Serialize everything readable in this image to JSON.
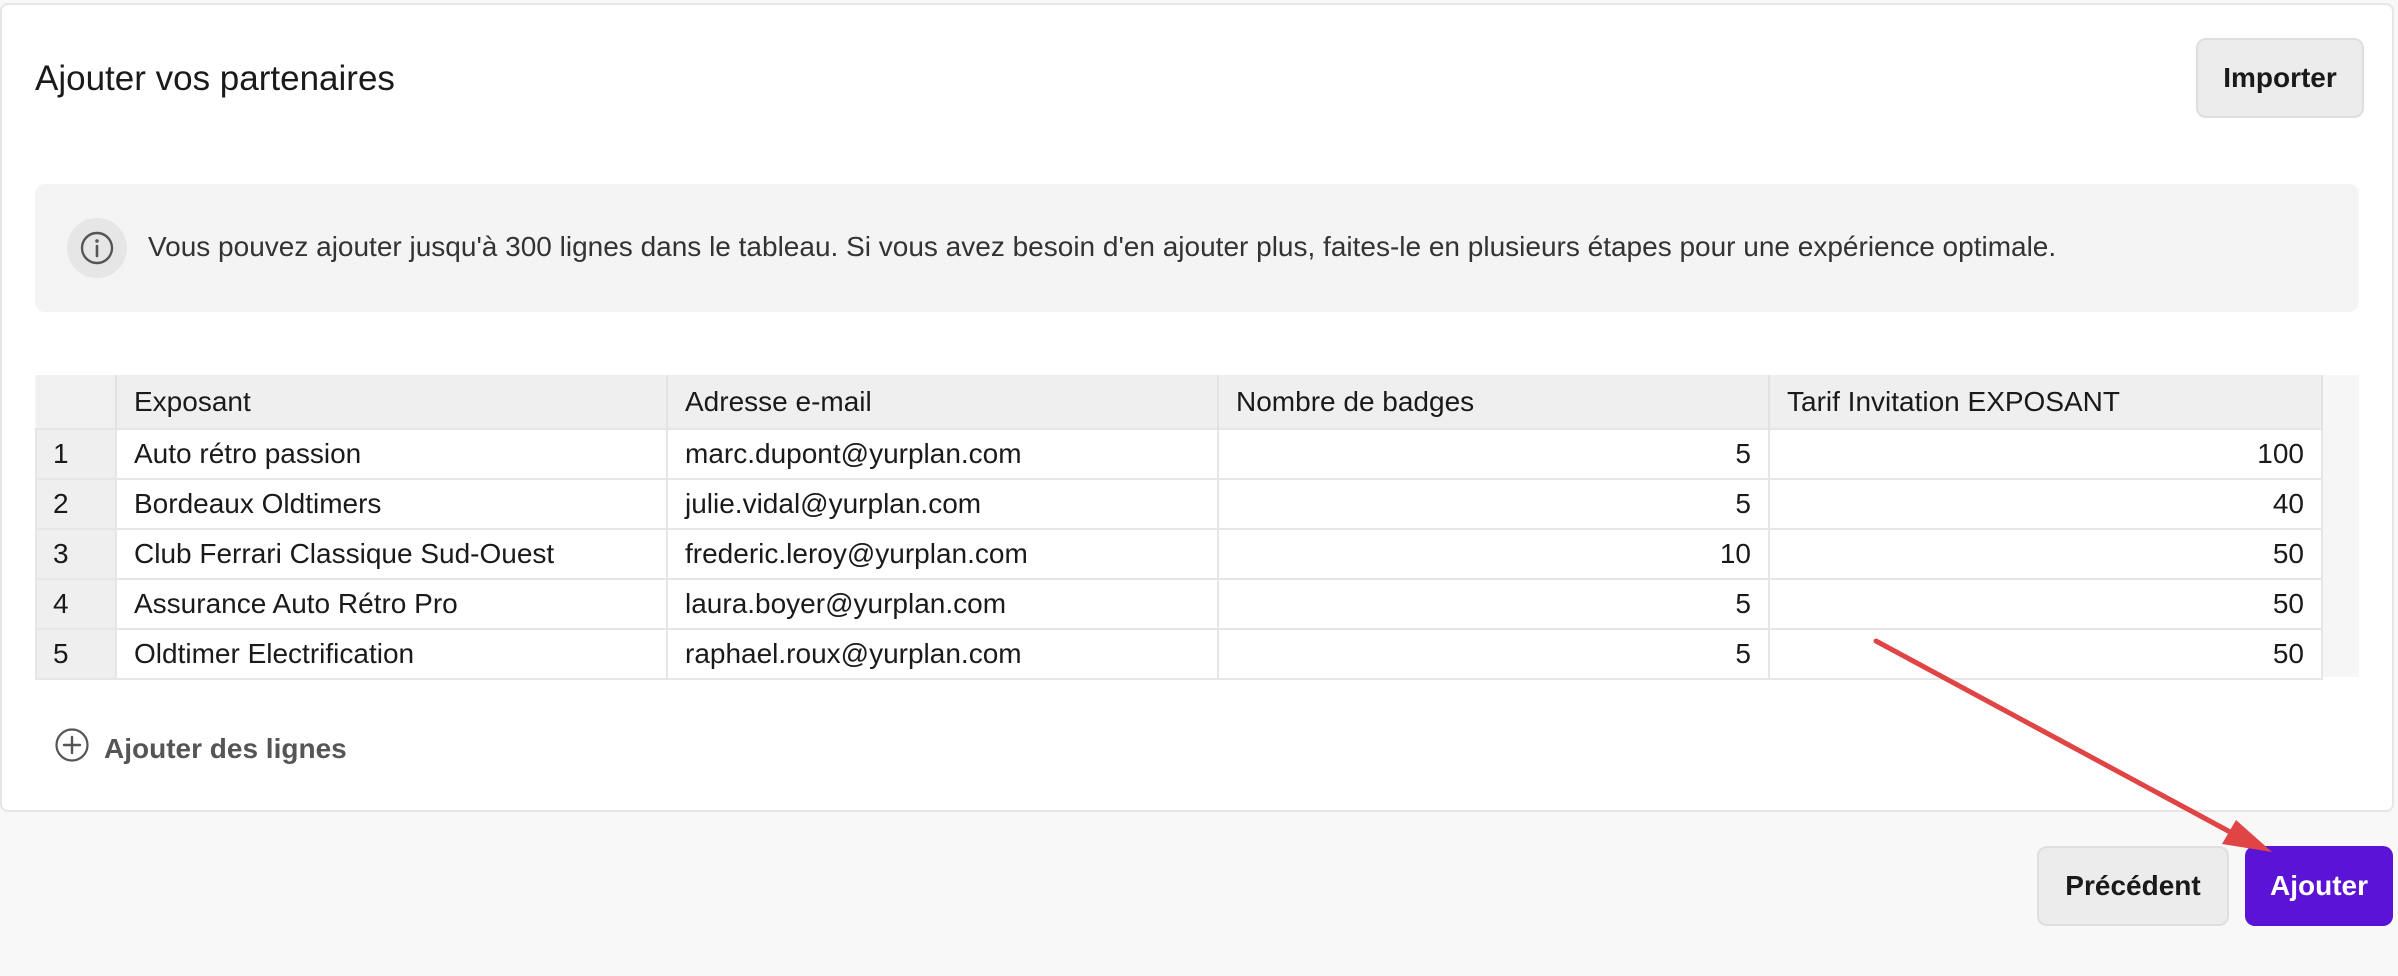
{
  "header": {
    "title": "Ajouter vos partenaires",
    "import_label": "Importer"
  },
  "info": {
    "icon": "info-icon",
    "text": "Vous pouvez ajouter jusqu'à 300 lignes dans le tableau. Si vous avez besoin d'en ajouter plus, faites-le en plusieurs étapes pour une expérience optimale."
  },
  "table": {
    "columns": [
      "Exposant",
      "Adresse e-mail",
      "Nombre de badges",
      "Tarif Invitation EXPOSANT"
    ],
    "rows": [
      {
        "index": "1",
        "exposant": "Auto rétro passion",
        "email": "marc.dupont@yurplan.com",
        "badges": "5",
        "tarif": "100"
      },
      {
        "index": "2",
        "exposant": "Bordeaux Oldtimers",
        "email": "julie.vidal@yurplan.com",
        "badges": "5",
        "tarif": "40"
      },
      {
        "index": "3",
        "exposant": "Club Ferrari Classique Sud-Ouest",
        "email": "frederic.leroy@yurplan.com",
        "badges": "10",
        "tarif": "50"
      },
      {
        "index": "4",
        "exposant": "Assurance Auto Rétro Pro",
        "email": "laura.boyer@yurplan.com",
        "badges": "5",
        "tarif": "50"
      },
      {
        "index": "5",
        "exposant": "Oldtimer Electrification",
        "email": "raphael.roux@yurplan.com",
        "badges": "5",
        "tarif": "50"
      }
    ]
  },
  "add_rows": {
    "icon": "plus-circle-icon",
    "label": "Ajouter des lignes"
  },
  "footer": {
    "previous_label": "Précédent",
    "submit_label": "Ajouter"
  },
  "colors": {
    "primary": "#5b14d6",
    "annotation_arrow": "#e04444"
  }
}
